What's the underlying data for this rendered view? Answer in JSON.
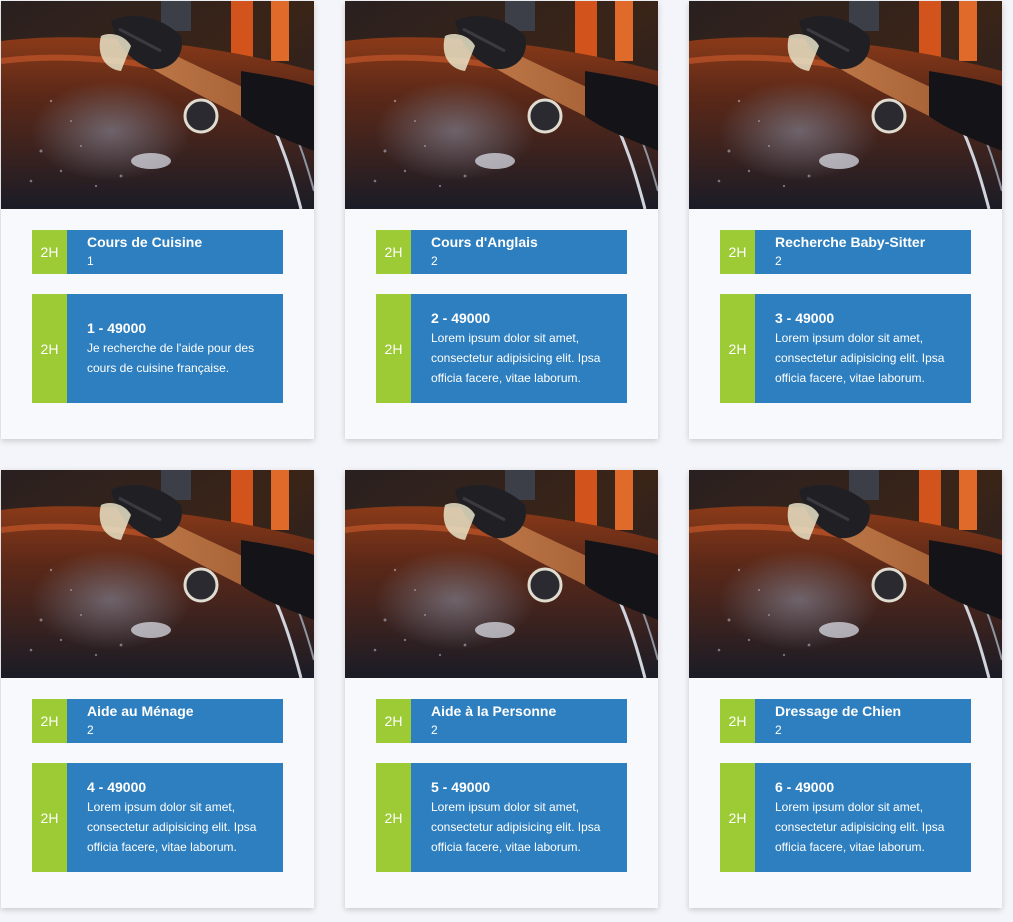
{
  "cards": [
    {
      "duration": "2H",
      "title": "Cours de Cuisine",
      "subtitle": "1",
      "detail_title": "1 - 49000",
      "description": "Je recherche de l'aide pour des cours de cuisine française."
    },
    {
      "duration": "2H",
      "title": "Cours d'Anglais",
      "subtitle": "2",
      "detail_title": "2 - 49000",
      "description": "Lorem ipsum dolor sit amet, consectetur adipisicing elit. Ipsa officia facere, vitae laborum."
    },
    {
      "duration": "2H",
      "title": "Recherche Baby-Sitter",
      "subtitle": "2",
      "detail_title": "3 - 49000",
      "description": "Lorem ipsum dolor sit amet, consectetur adipisicing elit. Ipsa officia facere, vitae laborum."
    },
    {
      "duration": "2H",
      "title": "Aide au Ménage",
      "subtitle": "2",
      "detail_title": "4 - 49000",
      "description": "Lorem ipsum dolor sit amet, consectetur adipisicing elit. Ipsa officia facere, vitae laborum."
    },
    {
      "duration": "2H",
      "title": "Aide à la Personne",
      "subtitle": "2",
      "detail_title": "5 - 49000",
      "description": "Lorem ipsum dolor sit amet, consectetur adipisicing elit. Ipsa officia facere, vitae laborum."
    },
    {
      "duration": "2H",
      "title": "Dressage de Chien",
      "subtitle": "2",
      "detail_title": "6 - 49000",
      "description": "Lorem ipsum dolor sit amet, consectetur adipisicing elit. Ipsa officia facere, vitae laborum."
    }
  ],
  "colors": {
    "accent_blue": "#2e7fbf",
    "accent_green": "#9ccb35",
    "card_background": "#f8f9fd",
    "page_background": "#f4f5fa"
  }
}
